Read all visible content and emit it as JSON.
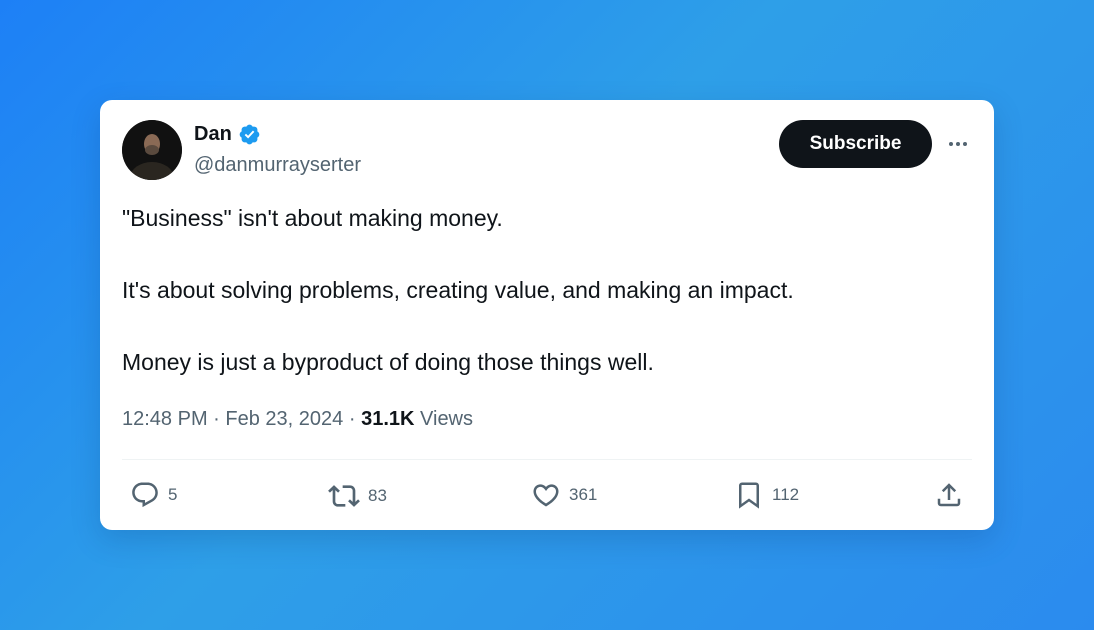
{
  "author": {
    "name": "Dan",
    "handle": "@danmurrayserter",
    "verified": true
  },
  "subscribe_label": "Subscribe",
  "tweet": {
    "paragraphs": [
      "\"Business\" isn't about making money.",
      "It's about solving problems, creating value, and making an impact.",
      "Money is just a byproduct of doing those things well."
    ]
  },
  "meta": {
    "time": "12:48 PM",
    "separator": "·",
    "date": "Feb 23, 2024",
    "views_count": "31.1K",
    "views_label": "Views"
  },
  "actions": {
    "replies": "5",
    "retweets": "83",
    "likes": "361",
    "bookmarks": "112"
  },
  "icons": {
    "verified": "verified-badge-icon",
    "more": "more-options-icon",
    "reply": "reply-icon",
    "retweet": "retweet-icon",
    "like": "heart-icon",
    "bookmark": "bookmark-icon",
    "share": "share-icon"
  },
  "colors": {
    "background_start": "#1d80f6",
    "background_end": "#2e9fe8",
    "card": "#ffffff",
    "verified_blue": "#1d9bf0",
    "text_primary": "#0f1419",
    "text_secondary": "#536471",
    "button_dark": "#0f1419"
  }
}
